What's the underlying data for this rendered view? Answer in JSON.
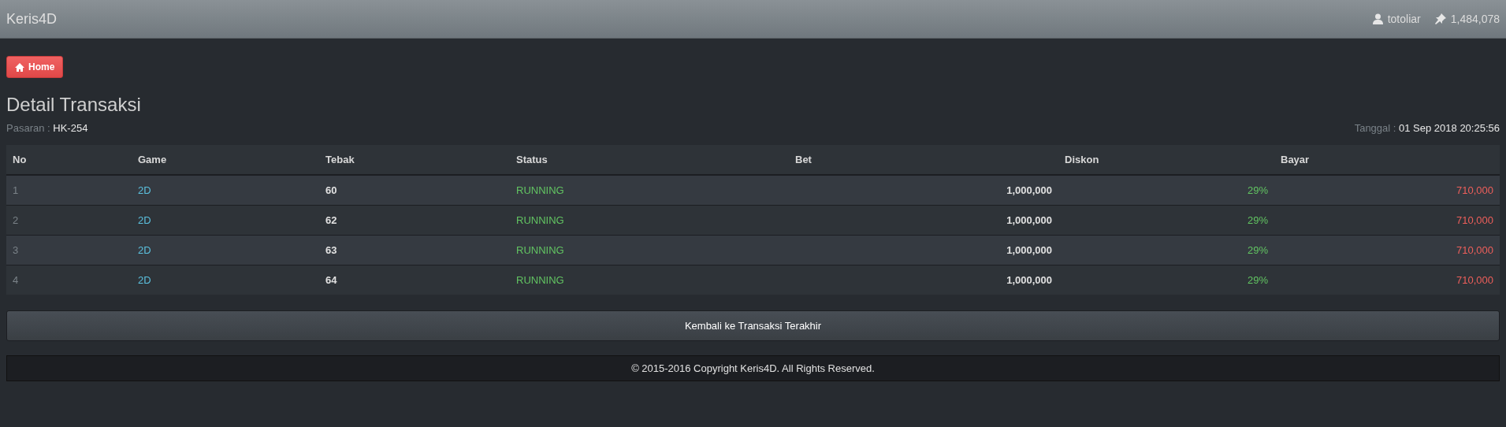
{
  "navbar": {
    "brand": "Keris4D",
    "username": "totoliar",
    "balance": "1,484,078"
  },
  "home_button": "Home",
  "title": "Detail Transaksi",
  "pasaran": {
    "label": "Pasaran :",
    "value": "HK-254"
  },
  "tanggal": {
    "label": "Tanggal :",
    "value": "01 Sep 2018 20:25:56"
  },
  "table": {
    "columns": [
      "No",
      "Game",
      "Tebak",
      "Status",
      "Bet",
      "Diskon",
      "Bayar"
    ],
    "rows": [
      {
        "no": "1",
        "game": "2D",
        "tebak": "60",
        "status": "RUNNING",
        "bet": "1,000,000",
        "diskon": "29%",
        "bayar": "710,000"
      },
      {
        "no": "2",
        "game": "2D",
        "tebak": "62",
        "status": "RUNNING",
        "bet": "1,000,000",
        "diskon": "29%",
        "bayar": "710,000"
      },
      {
        "no": "3",
        "game": "2D",
        "tebak": "63",
        "status": "RUNNING",
        "bet": "1,000,000",
        "diskon": "29%",
        "bayar": "710,000"
      },
      {
        "no": "4",
        "game": "2D",
        "tebak": "64",
        "status": "RUNNING",
        "bet": "1,000,000",
        "diskon": "29%",
        "bayar": "710,000"
      }
    ]
  },
  "back_button": "Kembali ke Transaksi Terakhir",
  "footer": "© 2015-2016 Copyright Keris4D. All Rights Reserved."
}
